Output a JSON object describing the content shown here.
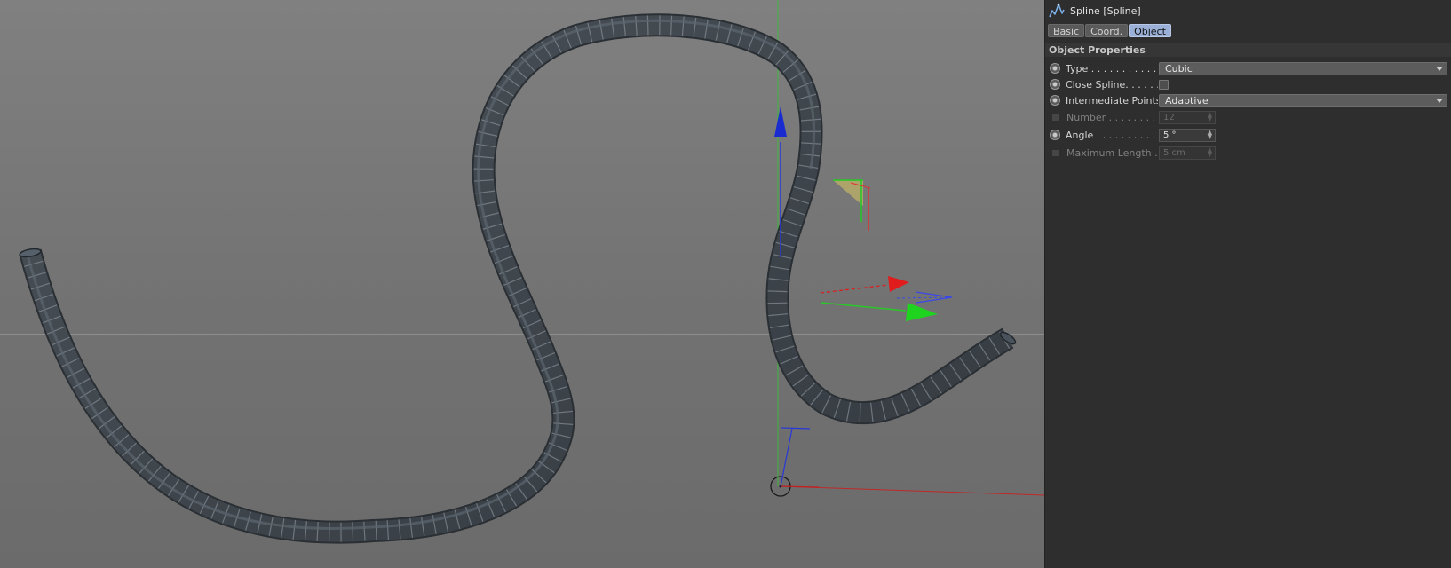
{
  "object": {
    "title": "Spline [Spline]",
    "icon": "spline-icon"
  },
  "tabs": [
    {
      "label": "Basic",
      "active": false
    },
    {
      "label": "Coord.",
      "active": false
    },
    {
      "label": "Object",
      "active": true
    }
  ],
  "section": {
    "title": "Object Properties"
  },
  "properties": {
    "type": {
      "label": "Type . . . . . . . . . . . .",
      "value": "Cubic"
    },
    "close_spline": {
      "label": "Close Spline. . . . . .",
      "checked": false
    },
    "intermediate_points": {
      "label": "Intermediate Points",
      "value": "Adaptive"
    },
    "number": {
      "label": "Number . . . . . . . . .",
      "value": "12",
      "disabled": true
    },
    "angle": {
      "label": "Angle . . . . . . . . . . .",
      "value": "5 °"
    },
    "maximum_length": {
      "label": "Maximum Length  .",
      "value": "5 cm",
      "disabled": true
    }
  },
  "colors": {
    "viewport_bg": "#7a7a7a",
    "panel_bg": "#2e2e2e",
    "active_tab": "#9ab0d6",
    "axis_x": "#e02020",
    "axis_y": "#20c020",
    "axis_z": "#2040e0",
    "tube": "#3f454c"
  }
}
